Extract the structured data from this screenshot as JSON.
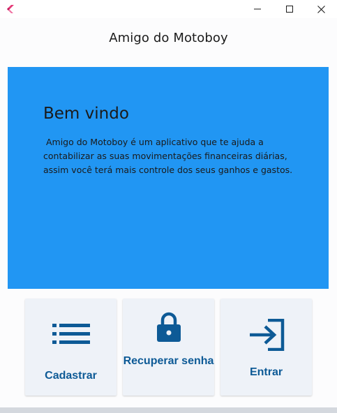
{
  "window": {
    "icons": {
      "app": "flutter-app-icon",
      "minimize": "minimize-icon",
      "maximize": "maximize-icon",
      "close": "close-icon"
    }
  },
  "appbar": {
    "title": "Amigo do Motoboy"
  },
  "hero": {
    "title": "Bem vindo",
    "text": " Amigo do Motoboy é um aplicativo que te ajuda a contabilizar as suas movimentações financeiras diárias, assim você terá mais controle dos seus ganhos e gastos.",
    "background": "#2196f3"
  },
  "actions": [
    {
      "label": "Cadastrar",
      "icon": "list-icon"
    },
    {
      "label": "Recuperar senha",
      "icon": "lock-icon"
    },
    {
      "label": "Entrar",
      "icon": "login-icon"
    }
  ],
  "colors": {
    "accent": "#0d5a96",
    "card_background": "#eef2f8"
  }
}
